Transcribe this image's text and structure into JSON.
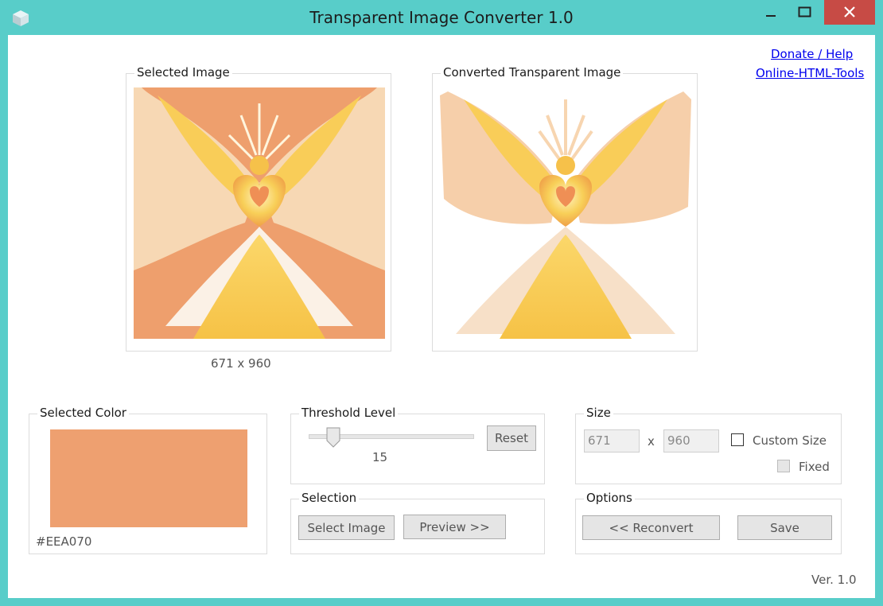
{
  "window": {
    "title": "Transparent Image Converter 1.0",
    "titlebar_color": "#58cdc9",
    "close_color": "#c74b45"
  },
  "links": {
    "donate": "Donate / Help",
    "online": "Online-HTML-Tools"
  },
  "selected_image": {
    "label": "Selected Image",
    "dimensions": "671 x 960"
  },
  "converted_image": {
    "label": "Converted Transparent Image"
  },
  "selected_color": {
    "label": "Selected Color",
    "hex_text": "#EEA070",
    "swatch": "#eea070"
  },
  "threshold": {
    "label": "Threshold Level",
    "value": "15",
    "level_fraction": 0.15,
    "reset_label": "Reset"
  },
  "size": {
    "label": "Size",
    "width": "671",
    "separator": "x",
    "height": "960",
    "custom_size_label": "Custom Size",
    "custom_size_checked": false,
    "fixed_label": "Fixed",
    "fixed_checked": false
  },
  "selection": {
    "label": "Selection",
    "select_image_label": "Select Image",
    "preview_label": "Preview >>"
  },
  "options": {
    "label": "Options",
    "reconvert_label": "<< Reconvert",
    "save_label": "Save"
  },
  "version": "Ver. 1.0"
}
